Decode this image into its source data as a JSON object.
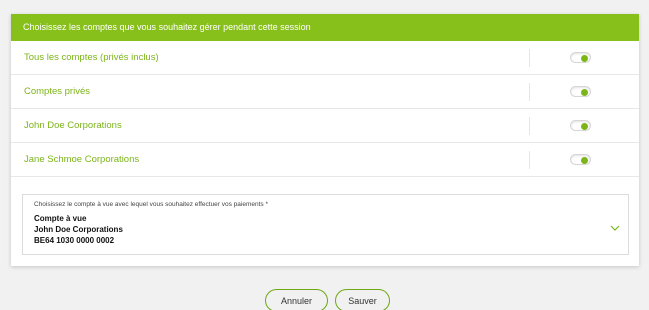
{
  "header": {
    "title": "Choisissez les comptes que vous souhaitez gérer pendant cette session"
  },
  "accounts": [
    {
      "label": "Tous les comptes (privés inclus)",
      "enabled": true
    },
    {
      "label": "Comptes privés",
      "enabled": true
    },
    {
      "label": "John Doe Corporations",
      "enabled": true
    },
    {
      "label": "Jane Schmoe Corporations",
      "enabled": true
    }
  ],
  "payment_account": {
    "label": "Choisissez le compte à vue avec lequel vous souhaitez effectuer vos paiements *",
    "type": "Compte à vue",
    "holder": "John Doe Corporations",
    "iban": "BE64 1030 0000 0002"
  },
  "buttons": {
    "cancel": "Annuler",
    "save": "Sauver"
  },
  "colors": {
    "accent": "#88c01b",
    "text_accent": "#7cb518"
  },
  "icons": {
    "toggle": "toggle-switch",
    "select": "chevron-down-icon"
  }
}
